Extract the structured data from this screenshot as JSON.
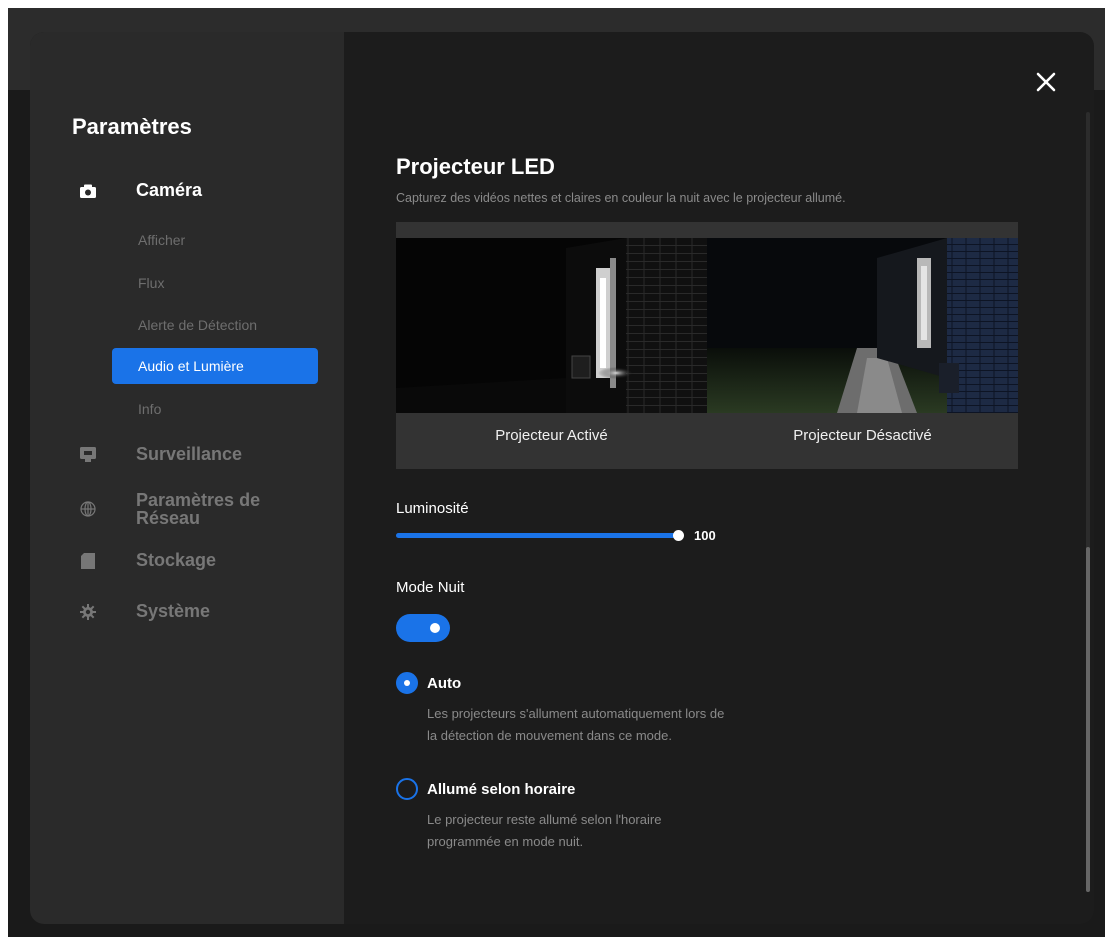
{
  "sidebar": {
    "title": "Paramètres",
    "camera": {
      "label": "Caméra",
      "icon": "camera-icon"
    },
    "sub_items": [
      "Afficher",
      "Flux",
      "Alerte de Détection",
      "Audio et Lumière",
      "Info"
    ],
    "active_sub": "Audio et Lumière",
    "surveillance": {
      "label": "Surveillance",
      "icon": "monitor-icon"
    },
    "network": {
      "label_line1": "Paramètres de",
      "label_line2": "Réseau",
      "icon": "globe-icon"
    },
    "storage": {
      "label": "Stockage",
      "icon": "sd-card-icon"
    },
    "system": {
      "label": "Système",
      "icon": "gear-icon"
    }
  },
  "content": {
    "title": "Projecteur LED",
    "subtitle": "Capturez des vidéos nettes et claires en couleur la nuit avec le projecteur allumé.",
    "preview": {
      "left_caption": "Projecteur Activé",
      "right_caption": "Projecteur Désactivé"
    },
    "brightness": {
      "label": "Luminosité",
      "value": 100,
      "max": 100,
      "value_text": "100"
    },
    "night_mode": {
      "label": "Mode Nuit",
      "enabled": true
    },
    "options": [
      {
        "label": "Auto",
        "selected": true,
        "desc_line1": "Les projecteurs s'allument automatiquement lors de",
        "desc_line2": "la détection de mouvement dans ce mode."
      },
      {
        "label": "Allumé selon horaire",
        "selected": false,
        "desc_line1": "Le projecteur reste allumé selon l'horaire",
        "desc_line2": "programmée en mode nuit."
      }
    ]
  },
  "colors": {
    "accent": "#1a73e8",
    "sidebar_bg": "#2a2a2a",
    "content_bg": "#1c1c1c"
  }
}
